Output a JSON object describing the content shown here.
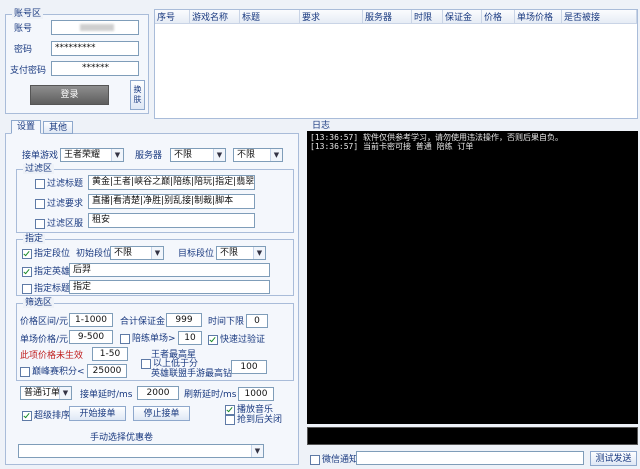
{
  "account": {
    "group_title": "账号区",
    "account_label": "账号",
    "account_value": "",
    "password_label": "密码",
    "password_value": "*********",
    "paypass_label": "支付密码",
    "paypass_value": "******",
    "login_button": "登录",
    "switch_button": "换肤"
  },
  "order_table": {
    "columns": [
      "序号",
      "游戏名称",
      "标题",
      "要求",
      "服务器",
      "时限",
      "保证金",
      "价格",
      "单场价格",
      "是否被接"
    ]
  },
  "tabs": [
    "设置",
    "其他"
  ],
  "settings": {
    "game_label": "接单游戏",
    "game_value": "王者荣耀",
    "server_label": "服务器",
    "server_value1": "不限",
    "server_value2": "不限",
    "filter": {
      "title": "过滤区",
      "items": [
        {
          "label": "过滤标题",
          "value": "黄金|王者|峡谷之巅|陪练|陪玩|指定|翡翠",
          "checked": false
        },
        {
          "label": "过滤要求",
          "value": "直播|看清楚|净胜|别乱接|制裁|脚本",
          "checked": false
        },
        {
          "label": "过滤区服",
          "value": "租安",
          "checked": false
        }
      ]
    },
    "specify": {
      "title": "指定",
      "rank_check": "指定段位",
      "initial_rank_label": "初始段位",
      "initial_rank_value": "不限",
      "target_rank_label": "目标段位",
      "target_rank_value": "不限",
      "hero_check": "指定英雄",
      "hero_value": "后羿",
      "title_check": "指定标题",
      "title_value": "指定"
    },
    "screen": {
      "title": "筛选区",
      "price_range_label": "价格区间/元",
      "price_range_value": "1-1000",
      "deposit_label": "合计保证金",
      "deposit_value": "999",
      "time_label": "时间下限",
      "time_value": "0",
      "single_price_label": "单场价格/元",
      "single_price_value": "9-500",
      "coach_label": "陪练单场>",
      "coach_value": "10",
      "quick_verify": "快速过验证",
      "price_not_effective": "此项价格未生效",
      "price_not_effective_value": "1-50",
      "king_highest": "王者最高星",
      "peak_score": "巅峰赛积分<",
      "peak_score_value": "25000",
      "above_score": "以上低于分",
      "king_fight": "英雄联盟手游最高钻",
      "king_value": "100"
    },
    "bottom": {
      "order_type": "普通订单",
      "delay_label": "接单延时/ms",
      "delay_value": "2000",
      "refresh_label": "刷新延时/ms",
      "refresh_value": "1000",
      "super_sort": "超级排序",
      "start_button": "开始接单",
      "stop_button": "停止接单",
      "play_music": "播放音乐",
      "close_after": "抢到后关闭",
      "coupon_label": "手动选择优惠卷",
      "coupon_value": ""
    }
  },
  "log": {
    "title": "日志",
    "lines": [
      "[13:36:57] 软件仅供参考学习，请勿使用违法操作，否则后果自负。",
      "[13:36:57] 当前卡密可接 普通 陪练 订单"
    ]
  },
  "footer": {
    "wechat_label": "微信通知",
    "wechat_value": "",
    "test_button": "测试发送"
  }
}
